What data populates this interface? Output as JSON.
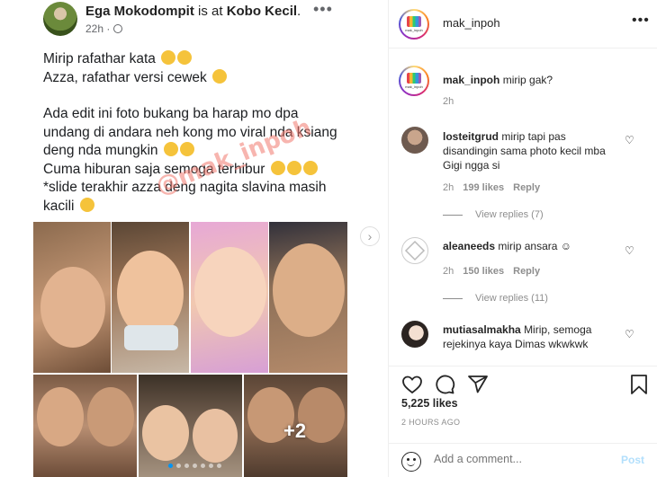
{
  "post": {
    "author": "Ega Mokodompit",
    "is_at": "is at",
    "location": "Kobo Kecil",
    "time": "22h ·",
    "lines": [
      "Mirip rafathar kata",
      "Azza, rafathar versi cewek",
      "",
      "Ada edit ini foto bukang ba harap mo dpa",
      "undang di andara neh kong mo viral nda ksiang",
      "deng nda mungkin",
      "Cuma hiburan saja semoga terhibur",
      "*slide terakhir azza deng nagita slavina masih",
      "kacili"
    ],
    "watermark": "@mak_inpoh",
    "more_photos": "+2"
  },
  "account": {
    "username": "mak_inpoh",
    "logo_text": "mak_inpoh"
  },
  "caption": {
    "username": "mak_inpoh",
    "text": "mirip gak?",
    "time": "2h"
  },
  "comments": [
    {
      "username": "losteitgrud",
      "text": "mirip tapi pas disandingin sama photo kecil mba Gigi ngga si",
      "time": "2h",
      "likes": "199 likes",
      "reply": "Reply",
      "view_replies": "View replies (7)"
    },
    {
      "username": "aleaneeds",
      "text": "mirip ansara",
      "time": "2h",
      "likes": "150 likes",
      "reply": "Reply",
      "view_replies": "View replies (11)"
    },
    {
      "username": "mutiasalmakha",
      "text": "Mirip, semoga rejekinya kaya Dimas wkwkwk",
      "time": "",
      "likes": "",
      "reply": "",
      "view_replies": ""
    }
  ],
  "stats": {
    "likes": "5,225 likes",
    "ago": "2 HOURS AGO"
  },
  "composer": {
    "placeholder": "Add a comment...",
    "post_label": "Post"
  }
}
